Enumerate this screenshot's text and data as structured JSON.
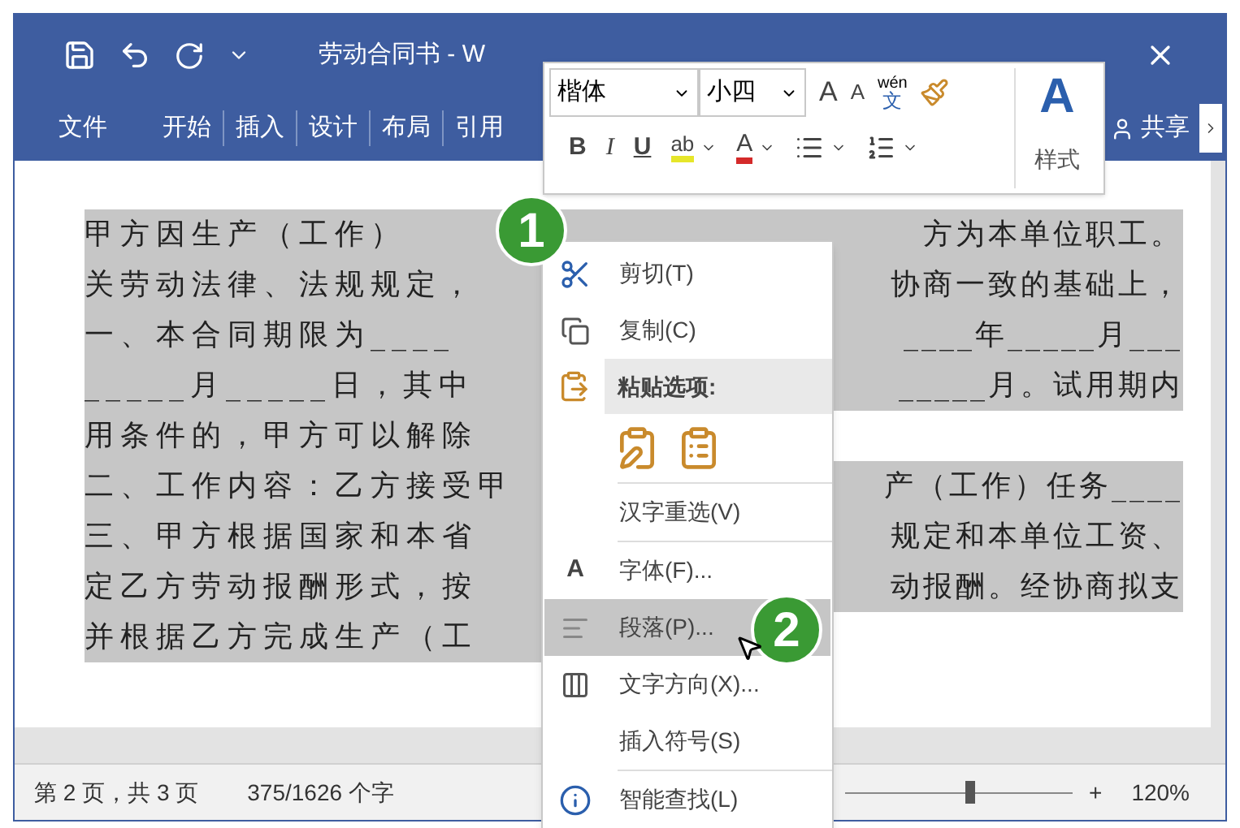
{
  "title_bar": {
    "title": "劳动合同书 - W"
  },
  "ribbon_tabs": [
    {
      "label": "文件"
    },
    {
      "label": "开始"
    },
    {
      "label": "插入"
    },
    {
      "label": "设计"
    },
    {
      "label": "布局"
    },
    {
      "label": "引用"
    }
  ],
  "share": "共享",
  "mini_toolbar": {
    "font": "楷体",
    "size": "小四",
    "grow": "A",
    "shrink": "A",
    "phonetic_top": "wén",
    "phonetic_char": "文",
    "bold": "B",
    "italic": "I",
    "underline": "U",
    "highlight": "ab",
    "font_color": "A",
    "styles_icon_text": "A",
    "styles_label": "样式"
  },
  "document": {
    "lines": [
      {
        "left": "甲方因生产（工作）",
        "right": "方为本单位职工。"
      },
      {
        "left": "关劳动法律、法规规定，",
        "right": "协商一致的基础上，"
      },
      {
        "left": "一、本合同期限为____",
        "right": "____年_____月___"
      },
      {
        "left": "_____月_____日，其中",
        "right": "_____月。试用期内"
      },
      {
        "left": "用条件的，甲方可以解除"
      },
      {
        "left": "二、工作内容：乙方接受甲",
        "right": "产（工作）任务____"
      },
      {
        "left": "三、甲方根据国家和本省",
        "right": "规定和本单位工资、"
      },
      {
        "left": "定乙方劳动报酬形式，按",
        "right": "动报酬。经协商拟支"
      },
      {
        "left": "并根据乙方完成生产（工"
      }
    ]
  },
  "context_menu": {
    "items": [
      {
        "kind": "command",
        "label": "剪切(T)",
        "selected": false
      },
      {
        "kind": "command",
        "label": "复制(C)",
        "selected": false
      },
      {
        "kind": "header",
        "label": "粘贴选项:"
      },
      {
        "kind": "paste_options"
      },
      {
        "kind": "command",
        "label": "汉字重选(V)",
        "selected": false,
        "separator": true
      },
      {
        "kind": "command",
        "label": "字体(F)...",
        "icon_text": "A",
        "selected": false,
        "separator": true
      },
      {
        "kind": "command",
        "label": "段落(P)...",
        "selected": true
      },
      {
        "kind": "command",
        "label": "文字方向(X)...",
        "selected": false
      },
      {
        "kind": "command",
        "label": "插入符号(S)",
        "selected": false
      },
      {
        "kind": "command",
        "label": "智能查找(L)",
        "selected": false,
        "separator": true
      }
    ]
  },
  "badges": [
    "1",
    "2"
  ],
  "status_bar": {
    "page": "第 2 页，共 3 页",
    "words": "375/1626 个字",
    "zoom_in": "+",
    "zoom": "120%",
    "zoom_slider": {
      "level": 0.55
    }
  }
}
